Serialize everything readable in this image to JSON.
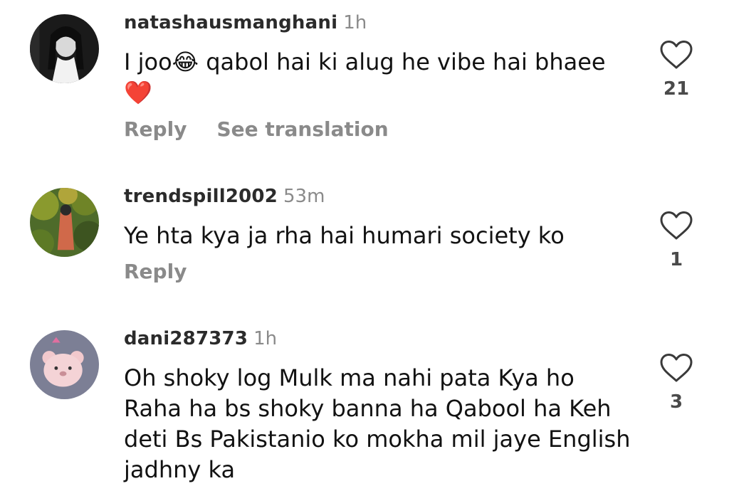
{
  "comments": [
    {
      "username": "natashausmanghani",
      "time": "1h",
      "text": "I joo😂 qabol hai ki alug he vibe hai bhaee ❤️",
      "reply_label": "Reply",
      "translate_label": "See translation",
      "likes": "21"
    },
    {
      "username": "trendspill2002",
      "time": "53m",
      "text": "Ye hta kya ja rha hai humari society ko",
      "reply_label": "Reply",
      "likes": "1"
    },
    {
      "username": "dani287373",
      "time": "1h",
      "text": "Oh shoky log Mulk ma  nahi pata Kya ho Raha ha bs shoky banna ha Qabool ha Keh deti Bs Pakistanio ko mokha mil jaye English jadhny ka",
      "likes": "3"
    }
  ],
  "icons": {
    "like": "heart-outline-icon"
  },
  "colors": {
    "username": "#2b2b2b",
    "muted": "#8a8a8a",
    "text": "#121212"
  }
}
